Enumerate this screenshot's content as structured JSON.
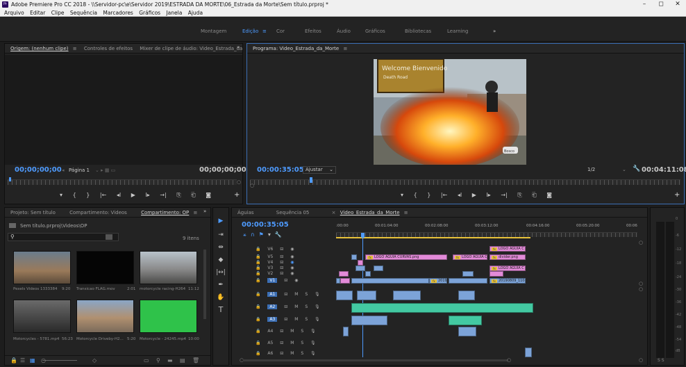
{
  "window": {
    "title": "Adobe Premiere Pro CC 2018 - \\\\Servidor-pc\\e\\Servidor 2019\\ESTRADA DA MORTE\\06_Estrada da Morte\\Sem título.prproj *",
    "app_icon": "Pr",
    "minimize_label": "–",
    "maximize_label": "◻",
    "close_label": "✕"
  },
  "menu": [
    "Arquivo",
    "Editar",
    "Clipe",
    "Sequência",
    "Marcadores",
    "Gráficos",
    "Janela",
    "Ajuda"
  ],
  "workspaces": {
    "items": [
      "Montagem",
      "Edição",
      "Cor",
      "Efeitos",
      "Áudio",
      "Gráficos",
      "Bibliotecas",
      "Learning"
    ],
    "active": "Edição",
    "menu_glyph": "≡",
    "more_glyph": "»"
  },
  "source_panel": {
    "tabs": [
      "Origem: (nenhum clipe)",
      "Controles de efeitos",
      "Mixer de clipe de áudio: Video_Estrada_da"
    ],
    "tab_menu": "≡",
    "more": "»",
    "timecode_in": "00;00;00;00",
    "page_label": "Página 1",
    "timecode_out": "00;00;00;00"
  },
  "program_panel": {
    "tab": "Programa: Video_Estrada_da_Morte",
    "tab_menu": "≡",
    "timecode": "00:00:35:05",
    "fit_label": "Ajustar",
    "resolution": "1/2",
    "duration": "00:04:11:08",
    "sign_text_1": "Welcome Bienvenido",
    "sign_text_2": "Death Road",
    "watermark": "Bosco"
  },
  "transport_glyphs": {
    "mark_in": "▾",
    "brace_open": "{",
    "brace_close": "}",
    "go_in": "|←",
    "step_back": "◂I",
    "play": "▶",
    "step_fwd": "I▸",
    "go_out": "→|",
    "insert": "⎘",
    "overwrite": "⎗",
    "camera": "◙",
    "plus": "+"
  },
  "project_panel": {
    "tabs": [
      "Projeto: Sem título",
      "Compartimento: Videos",
      "Compartimento: OP"
    ],
    "active_tab": "Compartimento: OP",
    "tab_menu": "≡",
    "more": "»",
    "path": "Sem título.prproj\\Videos\\OP",
    "search_placeholder": "",
    "items_count": "9 itens",
    "clips": [
      {
        "name": "Pexels Videos 1333384....",
        "duration": "9:20",
        "color": "#7a6a5a"
      },
      {
        "name": "Transicao FLAG.mov",
        "duration": "2:01",
        "color": "#0a0a0a"
      },
      {
        "name": "motorcycle racing-H264...",
        "duration": "11:12",
        "color": "#8a8e92"
      },
      {
        "name": "Motorcycles - 5781.mp4",
        "duration": "56:23",
        "color": "#4a4a4a"
      },
      {
        "name": "Motorcycle Driveby-H2...",
        "duration": "5:20",
        "color": "#a08a6a"
      },
      {
        "name": "Motorcycle - 24245.mp4",
        "duration": "10:00",
        "color": "#2fc24a"
      }
    ]
  },
  "tools": [
    "▶",
    "⇥",
    "⇹",
    "◆",
    "|↔|",
    "✒",
    "✋",
    "T"
  ],
  "timeline": {
    "tabs": [
      "Águias",
      "Sequência 05",
      "Video_Estrada_da_Morte"
    ],
    "active_tab": "Video_Estrada_da_Morte",
    "close": "×",
    "tab_menu": "≡",
    "timecode": "00:00:35:05",
    "ruler_labels": [
      ":00:00",
      "00:01:04:00",
      "00:02:08:00",
      "00:03:12:00",
      "00:04:16:00",
      "00:05:20:00",
      "00:06"
    ],
    "video_tracks": [
      "V6",
      "V5",
      "V4",
      "V3",
      "V2",
      "V1"
    ],
    "audio_tracks": [
      "A1",
      "A2",
      "A3",
      "A4",
      "A5",
      "A6"
    ],
    "clip_labels": {
      "logo1": "LOGO AGUIA C",
      "logo_curvas": "LOGO AGUIA CURVAS.png",
      "logo2": "LOGO AGUIA CL",
      "divider": "divider.png",
      "logo3": "LOGO AGUIA C",
      "v1a": "2019",
      "v1b": "20190809_1104",
      "fx": "fx"
    },
    "track_glyphs": {
      "lock": "🔒",
      "sync": "⊟",
      "eye": "👁",
      "mute": "M",
      "solo": "S",
      "mic": "🎙"
    }
  },
  "meter": {
    "ticks": [
      "0",
      "-6",
      "-12",
      "-18",
      "-24",
      "-30",
      "-36",
      "-42",
      "-48",
      "-54",
      "dB"
    ],
    "solo_labels": "S S"
  },
  "colors": {
    "accent": "#4e9bff",
    "clip_pink": "#e28ad8",
    "clip_blue": "#7ca3d8",
    "clip_green": "#43c9a2",
    "fx_yellow": "#e8c23a"
  }
}
